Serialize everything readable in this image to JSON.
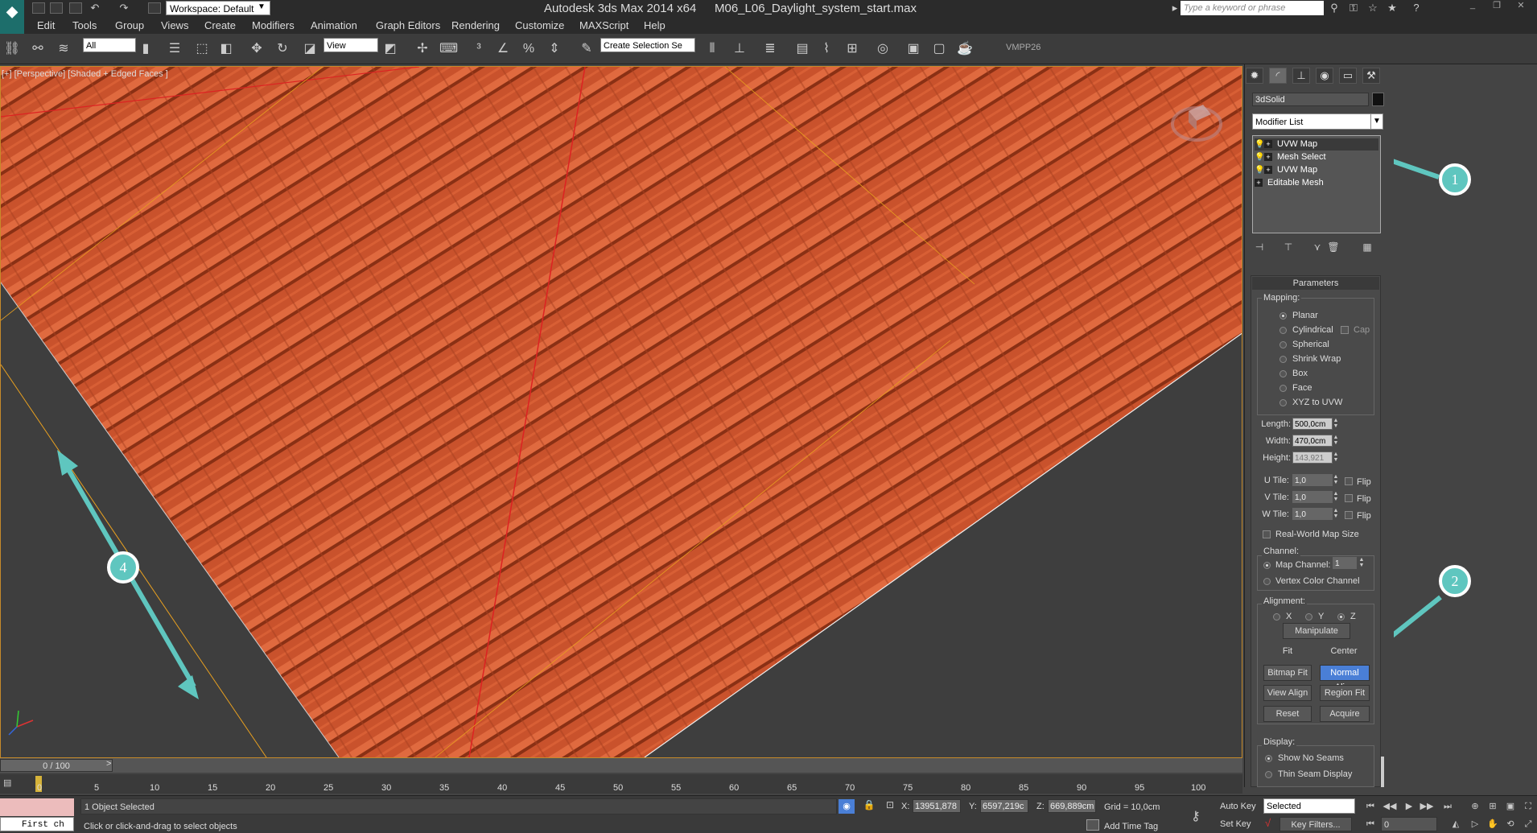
{
  "titlebar": {
    "workspace": "Workspace: Default",
    "app_title": "Autodesk 3ds Max  2014 x64",
    "file_title": "M06_L06_Daylight_system_start.max",
    "search_placeholder": "Type a keyword or phrase"
  },
  "menu": [
    "Edit",
    "Tools",
    "Group",
    "Views",
    "Create",
    "Modifiers",
    "Animation",
    "Graph Editors",
    "Rendering",
    "Customize",
    "MAXScript",
    "Help"
  ],
  "toolbar": {
    "filter": "All",
    "ref_coord": "View",
    "selection_set": "Create Selection Se",
    "vmpp_label": "VMPP26"
  },
  "viewport": {
    "label": "[+] [Perspective] [Shaded + Edged Faces ]"
  },
  "command_panel": {
    "object_name": "3dSolid",
    "modifier_list": "Modifier List",
    "stack": [
      "UVW Map",
      "Mesh Select",
      "UVW Map",
      "Editable Mesh"
    ],
    "params_title": "Parameters",
    "mapping_title": "Mapping:",
    "mapping_options": [
      "Planar",
      "Cylindrical",
      "Spherical",
      "Shrink Wrap",
      "Box",
      "Face",
      "XYZ to UVW"
    ],
    "cap_label": "Cap",
    "length_label": "Length:",
    "length_value": "500,0cm",
    "width_label": "Width:",
    "width_value": "470,0cm",
    "height_label": "Height:",
    "height_value": "143,921",
    "utile_label": "U Tile:",
    "utile_value": "1,0",
    "vtile_label": "V Tile:",
    "vtile_value": "1,0",
    "wtile_label": "W Tile:",
    "wtile_value": "1,0",
    "flip_label": "Flip",
    "realworld_label": "Real-World Map Size",
    "channel_title": "Channel:",
    "map_channel_label": "Map Channel:",
    "map_channel_value": "1",
    "vertex_color_label": "Vertex Color Channel",
    "alignment_title": "Alignment:",
    "axis_x": "X",
    "axis_y": "Y",
    "axis_z": "Z",
    "buttons": {
      "manipulate": "Manipulate",
      "fit": "Fit",
      "center": "Center",
      "bitmap_fit": "Bitmap Fit",
      "normal_align": "Normal Align",
      "view_align": "View Align",
      "region_fit": "Region Fit",
      "reset": "Reset",
      "acquire": "Acquire"
    },
    "display_title": "Display:",
    "show_no_seams": "Show No Seams",
    "thin_seam": "Thin Seam Display"
  },
  "callouts": [
    "1",
    "2",
    "4"
  ],
  "timeline": {
    "position": "0 / 100",
    "ticks": [
      "0",
      "5",
      "10",
      "15",
      "20",
      "25",
      "30",
      "35",
      "40",
      "45",
      "50",
      "55",
      "60",
      "65",
      "70",
      "75",
      "80",
      "85",
      "90",
      "95",
      "100"
    ]
  },
  "status": {
    "maxscript": "First ch",
    "selection": "1 Object Selected",
    "prompt": "Click or click-and-drag to select objects",
    "x_label": "X:",
    "x_value": "13951,878",
    "y_label": "Y:",
    "y_value": "6597,219c",
    "z_label": "Z:",
    "z_value": "669,889cm",
    "grid": "Grid = 10,0cm",
    "add_time_tag": "Add Time Tag",
    "auto_key": "Auto Key",
    "set_key": "Set Key",
    "key_mode": "Selected",
    "key_filters": "Key Filters...",
    "frame": "0"
  }
}
